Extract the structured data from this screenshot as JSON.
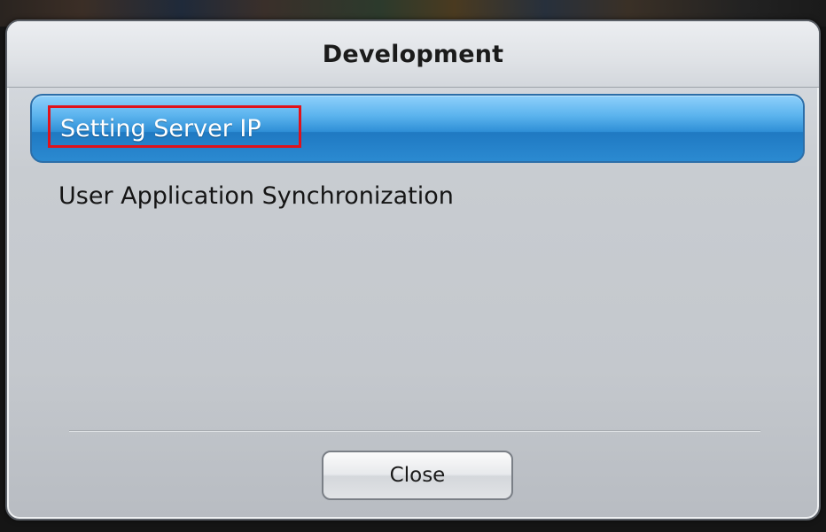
{
  "dialog": {
    "title": "Development",
    "items": [
      {
        "label": "Setting Server IP",
        "selected": true
      },
      {
        "label": "User Application Synchronization",
        "selected": false
      }
    ],
    "close_label": "Close"
  }
}
